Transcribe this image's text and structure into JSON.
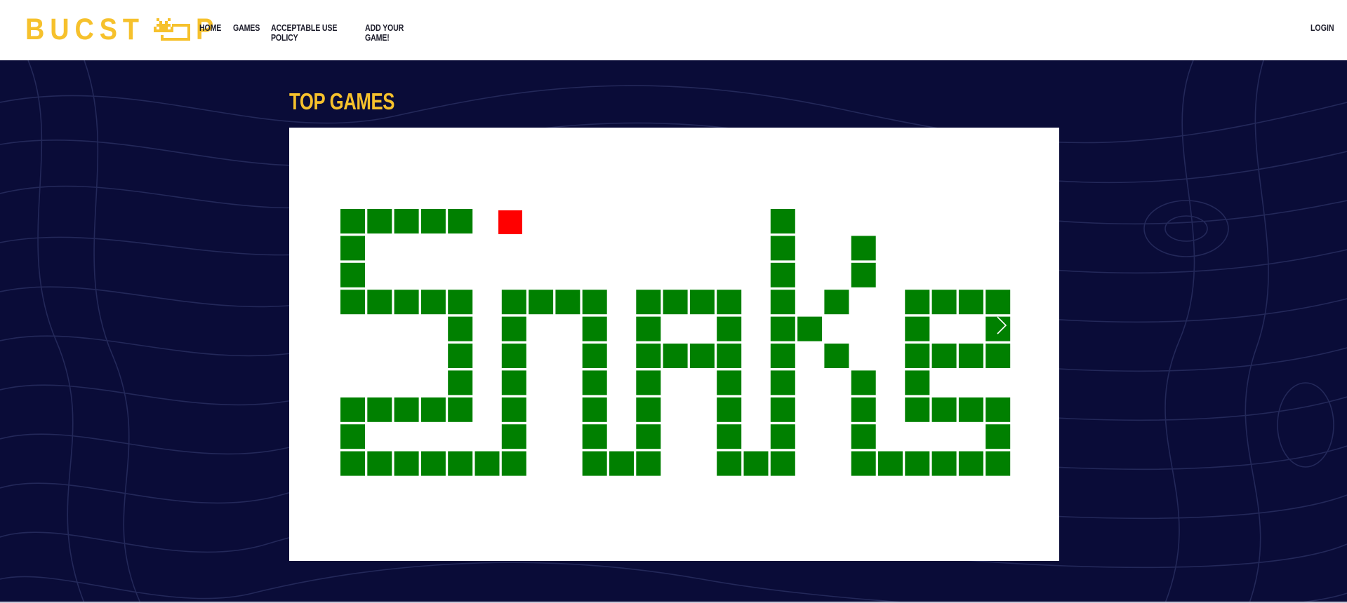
{
  "header": {
    "logo_text": "BUCST",
    "logo_tail": "P",
    "logo_icon": "space-invader-icon",
    "nav": [
      {
        "label": "HOME"
      },
      {
        "label": "GAMES"
      },
      {
        "label": "ACCEPTABLE USE POLICY"
      },
      {
        "label": "ADD YOUR GAME!"
      }
    ],
    "login_label": "LOGIN"
  },
  "main": {
    "section_title": "TOP GAMES",
    "carousel": {
      "current_slide": "Snake",
      "next_icon": "chevron-right-icon"
    }
  },
  "colors": {
    "brand_yellow": "#f6c12c",
    "background_navy": "#0a0c38",
    "snake_green": "#008000",
    "food_red": "#ff0000"
  }
}
